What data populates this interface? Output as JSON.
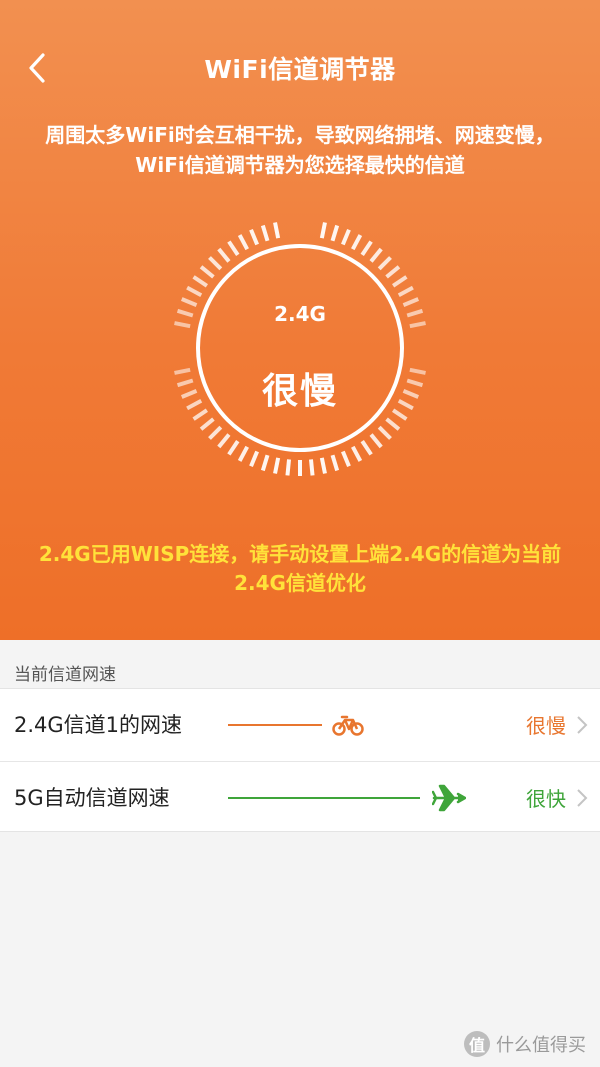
{
  "header": {
    "title": "WiFi信道调节器",
    "back_icon": "chevron-left-icon"
  },
  "intro": "周围太多WiFi时会互相干扰，导致网络拥堵、网速变慢，WiFi信道调节器为您选择最快的信道",
  "gauge": {
    "band": "2.4G",
    "speed": "很慢"
  },
  "warning": "2.4G已用WISP连接，请手动设置上端2.4G的信道为当前2.4G信道优化",
  "section": {
    "label": "当前信道网速"
  },
  "rows": [
    {
      "label": "2.4G信道1的网速",
      "status": "很慢",
      "icon": "bicycle-icon",
      "color": "#e8762f"
    },
    {
      "label": "5G自动信道网速",
      "status": "很快",
      "icon": "airplane-icon",
      "color": "#3fa53a"
    }
  ],
  "watermark": {
    "badge": "值",
    "text": "什么值得买"
  },
  "colors": {
    "hero_top": "#f29050",
    "hero_bottom": "#ee6f28",
    "warning": "#ffe23a",
    "slow": "#e8762f",
    "fast": "#3fa53a"
  }
}
